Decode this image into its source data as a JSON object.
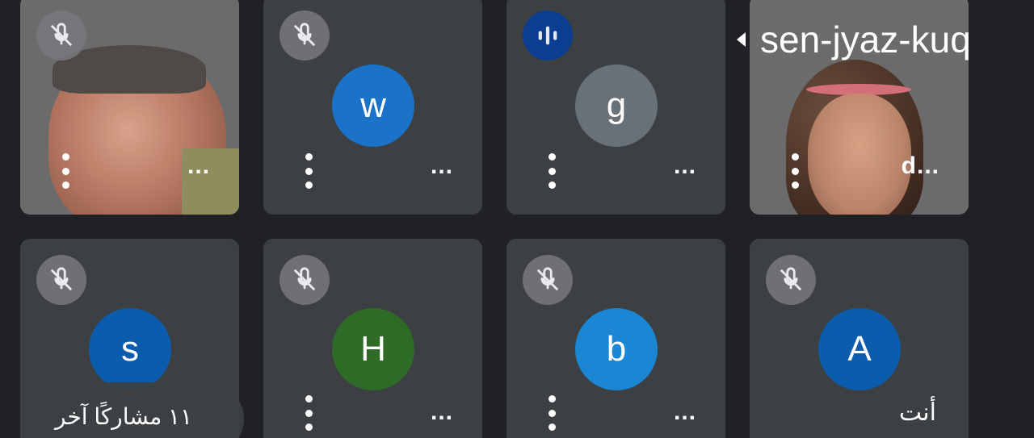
{
  "meeting": {
    "code": "sen-jyaz-kuq"
  },
  "tiles": [
    {
      "name": "...",
      "avatar_letter": "",
      "avatar_color": "",
      "video": true,
      "mic": "muted"
    },
    {
      "name": "...",
      "avatar_letter": "w",
      "avatar_color": "#1a73c9",
      "video": false,
      "mic": "muted"
    },
    {
      "name": "...",
      "avatar_letter": "g",
      "avatar_color": "#687178",
      "video": false,
      "mic": "speaking"
    },
    {
      "name": "d...",
      "avatar_letter": "",
      "avatar_color": "",
      "video": true,
      "mic": "none"
    },
    {
      "name": "",
      "avatar_letter": "s",
      "avatar_color": "#0b5cad",
      "video": false,
      "mic": "muted"
    },
    {
      "name": "...",
      "avatar_letter": "H",
      "avatar_color": "#2e6b26",
      "video": false,
      "mic": "muted"
    },
    {
      "name": "...",
      "avatar_letter": "b",
      "avatar_color": "#1a86d4",
      "video": false,
      "mic": "muted"
    },
    {
      "name": "أنت",
      "avatar_letter": "A",
      "avatar_color": "#0b5cad",
      "video": false,
      "mic": "muted"
    }
  ],
  "others": {
    "label": "١١ مشاركًا آخر"
  },
  "icons": {
    "mic_muted": "mic-off-icon",
    "mic_speaking": "audio-level-icon",
    "more": "more-vert-icon",
    "collapse": "caret-left-icon"
  }
}
